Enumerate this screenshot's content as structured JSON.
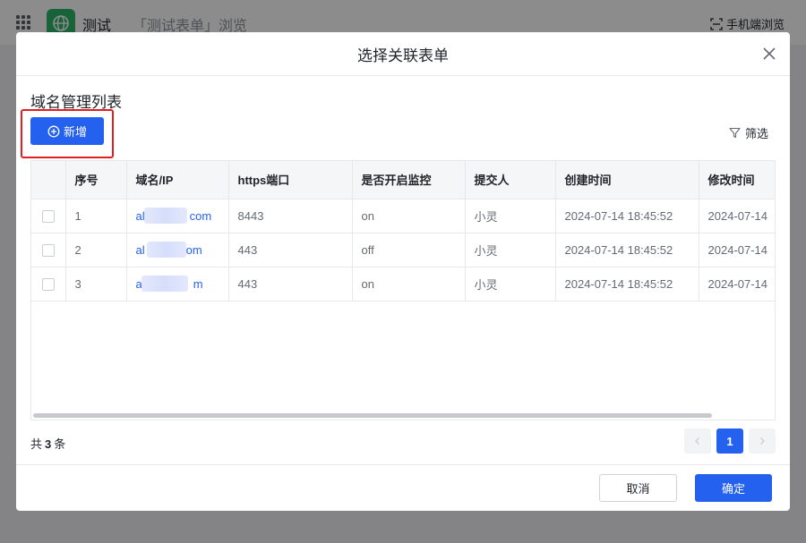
{
  "app": {
    "name": "测试",
    "breadcrumb": "「测试表单」浏览",
    "mobile_view": "手机端浏览"
  },
  "modal": {
    "title": "选择关联表单",
    "form_title": "域名管理列表",
    "add_label": "新增",
    "filter_label": "筛选",
    "columns": [
      "序号",
      "域名/IP",
      "https端口",
      "是否开启监控",
      "提交人",
      "创建时间",
      "修改时间"
    ],
    "rows": [
      {
        "index": "1",
        "domain_prefix": "al",
        "domain_suffix": "com",
        "port": "8443",
        "monitor": "on",
        "submitter": "小灵",
        "created": "2024-07-14 18:45:52",
        "modified": "2024-07-14"
      },
      {
        "index": "2",
        "domain_prefix": "al",
        "domain_suffix": "om",
        "port": "443",
        "monitor": "off",
        "submitter": "小灵",
        "created": "2024-07-14 18:45:52",
        "modified": "2024-07-14"
      },
      {
        "index": "3",
        "domain_prefix": "a",
        "domain_suffix": "m",
        "port": "443",
        "monitor": "on",
        "submitter": "小灵",
        "created": "2024-07-14 18:45:52",
        "modified": "2024-07-14"
      }
    ],
    "total_prefix": "共",
    "total_count": "3",
    "total_suffix": "条",
    "current_page": "1",
    "cancel_label": "取消",
    "ok_label": "确定"
  },
  "colors": {
    "primary": "#2561ef",
    "highlight_border": "#e02020",
    "app_logo": "#2fb46a"
  }
}
